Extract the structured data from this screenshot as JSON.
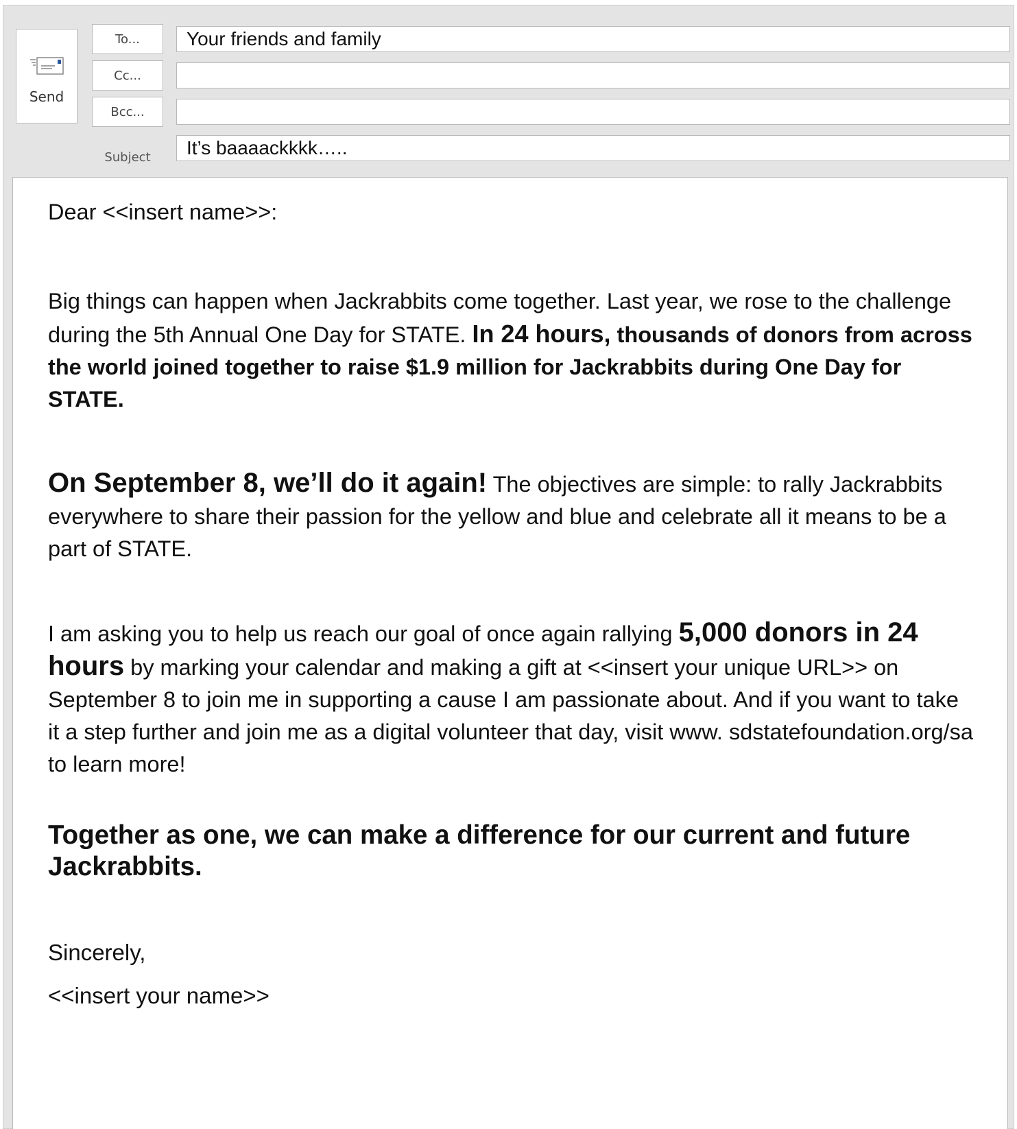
{
  "compose": {
    "send_label": "Send",
    "to_button": "To...",
    "cc_button": "Cc...",
    "bcc_button": "Bcc...",
    "subject_label": "Subject",
    "to_value": "Your friends and family",
    "cc_value": "",
    "bcc_value": "",
    "subject_value": "It’s baaaackkkk….."
  },
  "body": {
    "greeting": "Dear <<insert name>>:",
    "p1_normal": "Big things can happen when Jackrabbits come together.  Last year, we rose to the challenge during the 5th Annual One Day for STATE.  ",
    "p1_bold_a": "In 24 hours,",
    "p1_bold_b": " thousands of donors from across the world joined together to raise $1.9 million for Jackrabbits during One Day for STATE.",
    "p2_bold": "On September 8, we’ll do it again!",
    "p2_normal": "  The objectives are simple:  to rally Jackrabbits everywhere to share their passion for the yellow and blue and celebrate all it means to be a part of STATE.",
    "p3_normal_a": "I am asking you to help us reach our goal of once again rallying ",
    "p3_bold": "5,000 donors in 24 hours",
    "p3_normal_b": " by marking your calendar and making a gift at <<insert your unique URL>> on September 8 to join me in supporting a cause I am passionate about.  And if you want to take it a step further and join me as a digital volunteer that day, visit www. sdstatefoundation.org/sa to learn more!",
    "p4_bold": "Together as one, we can make a difference for our current and future Jackrabbits.",
    "closing": "Sincerely,",
    "signature": "<<insert your name>>"
  },
  "icons": [
    "send-mail-icon"
  ]
}
